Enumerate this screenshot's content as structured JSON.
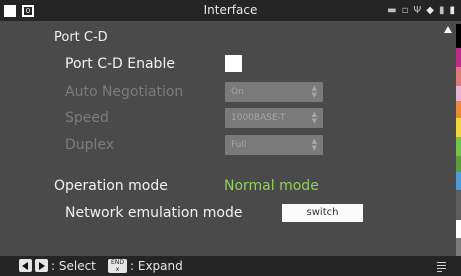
{
  "header": {
    "title": "Interface",
    "badge": "0"
  },
  "section": {
    "title": "Port C-D"
  },
  "settings": {
    "enable_label": "Port C-D Enable",
    "enable_checked": true,
    "autoneg_label": "Auto Negotiation",
    "autoneg_value": "On",
    "speed_label": "Speed",
    "speed_value": "1000BASE-T",
    "duplex_label": "Duplex",
    "duplex_value": "Full"
  },
  "operation": {
    "label": "Operation mode",
    "value": "Normal mode"
  },
  "emulation": {
    "label": "Network emulation mode",
    "button": "switch"
  },
  "footer": {
    "select_text": ": Select",
    "end_key_top": "END",
    "end_key_bottom": "x",
    "expand_text": ": Expand"
  },
  "status_icons": [
    "printer-icon",
    "network-icon",
    "usb-icon",
    "tag-icon",
    "sd-card-icon",
    "battery-icon"
  ],
  "colors": {
    "background": "#4a4a4a",
    "bar": "#252525",
    "accent_green": "#8fd15a",
    "disabled_text": "#7c7c7c",
    "strip": [
      "#000000",
      "#bf2a86",
      "#e07a7a",
      "#e5b5cf",
      "#e88a3a",
      "#f0d73c",
      "#73c04a",
      "#5f9a3e",
      "#4a9bd8",
      "#5d5d5d",
      "#ffffff",
      "#7a7a7a"
    ]
  }
}
